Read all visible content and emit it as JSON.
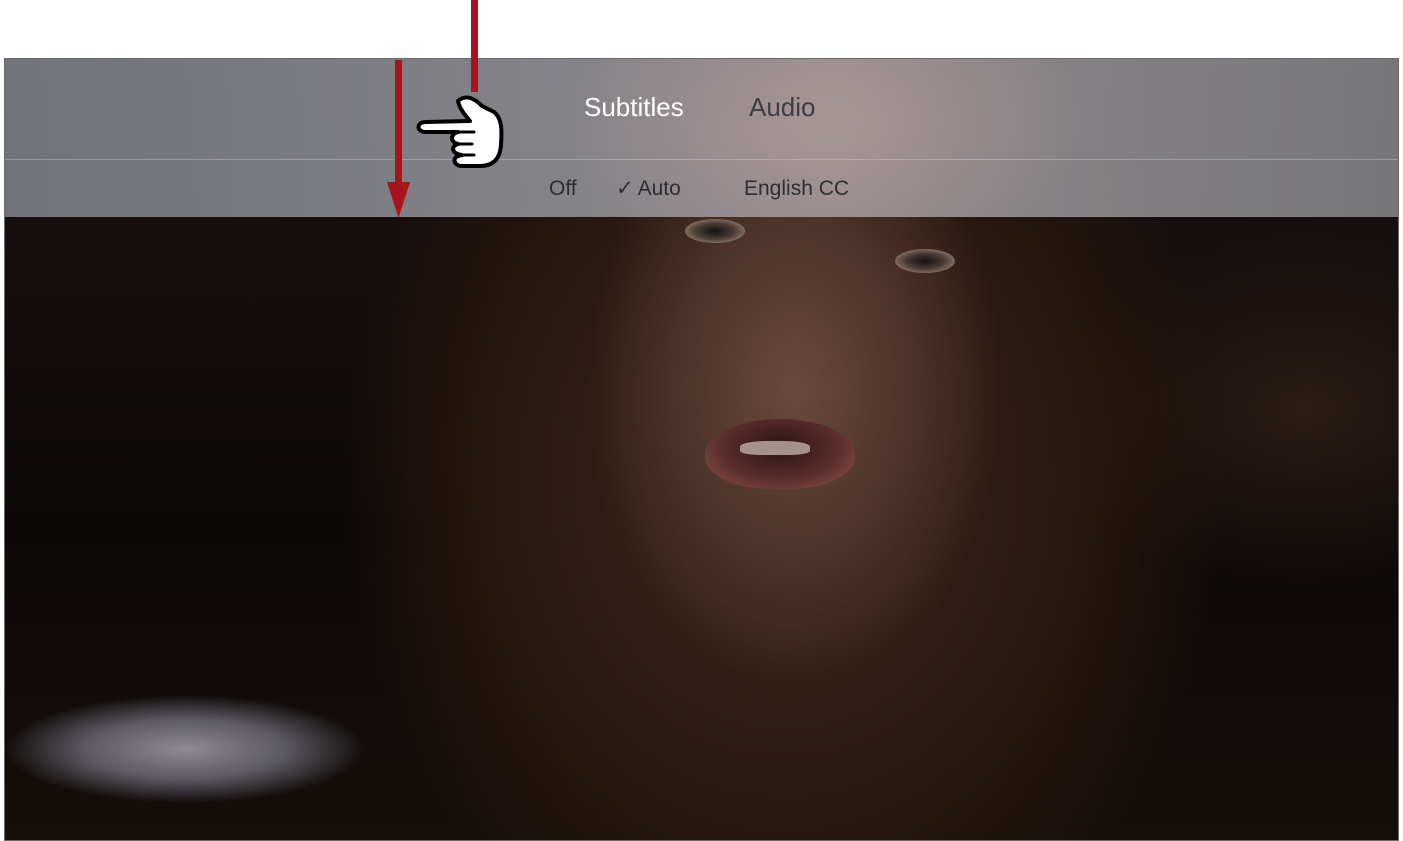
{
  "menu": {
    "tabs": [
      {
        "label": "Subtitles",
        "active": true
      },
      {
        "label": "Audio",
        "active": false
      }
    ],
    "options": [
      {
        "label": "Off",
        "selected": false
      },
      {
        "label": "Auto",
        "selected": true,
        "check": "✓"
      },
      {
        "label": "English CC",
        "selected": false
      }
    ]
  },
  "colors": {
    "annotation_arrow": "#a8141a",
    "active_tab": "#ffffff",
    "inactive_text": "#3e3e44"
  },
  "icons": {
    "pointer": "pointing-hand-icon",
    "check": "checkmark-icon",
    "arrow": "down-arrow-icon"
  }
}
